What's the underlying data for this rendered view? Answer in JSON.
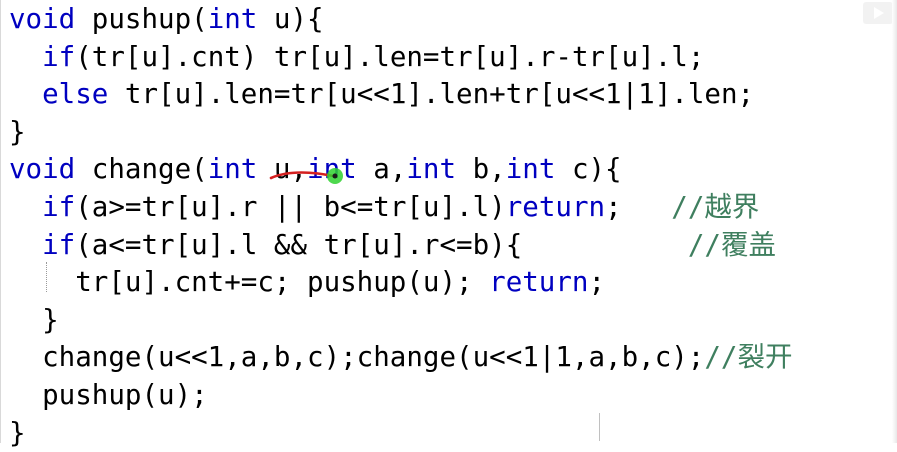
{
  "code_lines": [
    {
      "tokens": [
        {
          "t": "kw",
          "s": "void"
        },
        {
          "t": "pl",
          "s": " pushup("
        },
        {
          "t": "kw",
          "s": "int"
        },
        {
          "t": "pl",
          "s": " u){"
        }
      ]
    },
    {
      "tokens": [
        {
          "t": "pl",
          "s": "  "
        },
        {
          "t": "kw",
          "s": "if"
        },
        {
          "t": "pl",
          "s": "(tr[u].cnt) tr[u].len=tr[u].r-tr[u].l;"
        }
      ]
    },
    {
      "tokens": [
        {
          "t": "pl",
          "s": "  "
        },
        {
          "t": "kw",
          "s": "else"
        },
        {
          "t": "pl",
          "s": " tr[u].len=tr[u<<1].len+tr[u<<1|1].len;"
        }
      ]
    },
    {
      "tokens": [
        {
          "t": "pl",
          "s": "}"
        }
      ]
    },
    {
      "tokens": [
        {
          "t": "kw",
          "s": "void"
        },
        {
          "t": "pl",
          "s": " change("
        },
        {
          "t": "kw",
          "s": "int"
        },
        {
          "t": "pl",
          "s": " u,"
        },
        {
          "t": "kw",
          "s": "int"
        },
        {
          "t": "pl",
          "s": " a,"
        },
        {
          "t": "kw",
          "s": "int"
        },
        {
          "t": "pl",
          "s": " b,"
        },
        {
          "t": "kw",
          "s": "int"
        },
        {
          "t": "pl",
          "s": " c){"
        }
      ]
    },
    {
      "tokens": [
        {
          "t": "pl",
          "s": "  "
        },
        {
          "t": "kw",
          "s": "if"
        },
        {
          "t": "pl",
          "s": "(a>=tr[u].r || b<=tr[u].l)"
        },
        {
          "t": "kw",
          "s": "return"
        },
        {
          "t": "pl",
          "s": ";   "
        },
        {
          "t": "cmt",
          "s": "//越界"
        }
      ]
    },
    {
      "tokens": [
        {
          "t": "pl",
          "s": "  "
        },
        {
          "t": "kw",
          "s": "if"
        },
        {
          "t": "pl",
          "s": "(a<=tr[u].l && tr[u].r<=b){          "
        },
        {
          "t": "cmt",
          "s": "//覆盖"
        }
      ]
    },
    {
      "tokens": [
        {
          "t": "pl",
          "s": "    tr[u].cnt+=c; pushup(u); "
        },
        {
          "t": "kw",
          "s": "return"
        },
        {
          "t": "pl",
          "s": ";"
        }
      ]
    },
    {
      "tokens": [
        {
          "t": "pl",
          "s": "  }"
        }
      ]
    },
    {
      "tokens": [
        {
          "t": "pl",
          "s": "  change(u<<1,a,b,c);change(u<<1|1,a,b,c);"
        },
        {
          "t": "cmt",
          "s": "//裂开"
        }
      ]
    },
    {
      "tokens": [
        {
          "t": "pl",
          "s": "  pushup(u);"
        }
      ]
    },
    {
      "tokens": [
        {
          "t": "pl",
          "s": "}"
        }
      ]
    }
  ],
  "colors": {
    "keyword": "#7f0055",
    "comment": "#3f7f5f",
    "plain": "#000000",
    "pen_stroke": "#d42020",
    "pointer_dot": "#2fd12f"
  },
  "icons": [
    "play-icon"
  ]
}
